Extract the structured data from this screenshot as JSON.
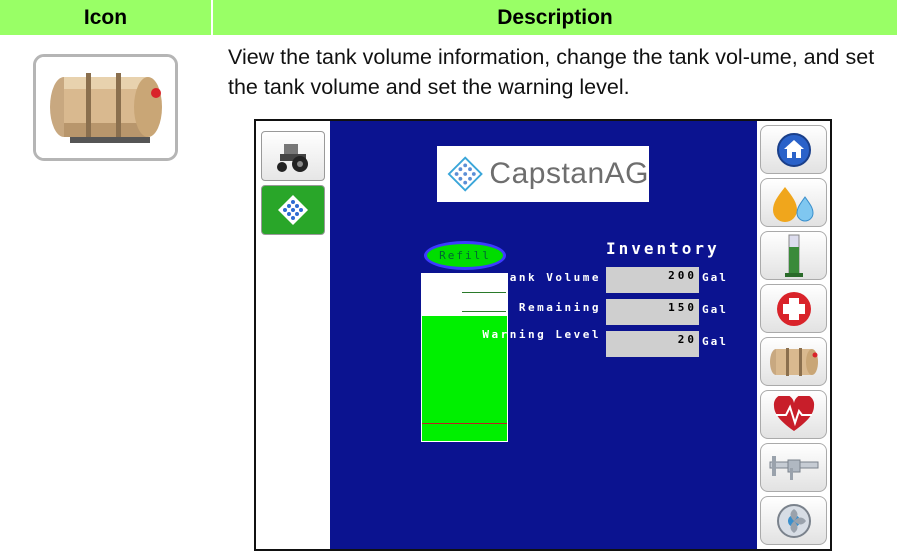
{
  "table": {
    "header_icon": "Icon",
    "header_description": "Description",
    "description": "View the tank volume information, change the tank vol-ume, and set the tank volume and set the warning level.",
    "icon_name": "tank-icon"
  },
  "screen": {
    "logo_text": "CapstanAG",
    "refill_label": "Refill",
    "inventory_title": "Inventory",
    "rows": [
      {
        "label": "Tank Volume",
        "value": "200",
        "unit": "Gal"
      },
      {
        "label": "Remaining",
        "value": "150",
        "unit": "Gal"
      },
      {
        "label": "Warning Level",
        "value": "20",
        "unit": "Gal"
      }
    ],
    "gauge_fill_fraction": 0.75,
    "gauge_warning_fraction": 0.1,
    "left_tabs": [
      "tractor-icon",
      "capstan-logo-icon"
    ],
    "right_buttons": [
      "home-icon",
      "fluid-drops-icon",
      "gauge-tube-icon",
      "first-aid-icon",
      "tank-icon",
      "heart-monitor-icon",
      "caliper-icon",
      "fan-icon"
    ],
    "colors": {
      "screen_bg": "#0b1390",
      "gauge_fill": "#00f000",
      "header_bg": "#99ff66"
    }
  }
}
